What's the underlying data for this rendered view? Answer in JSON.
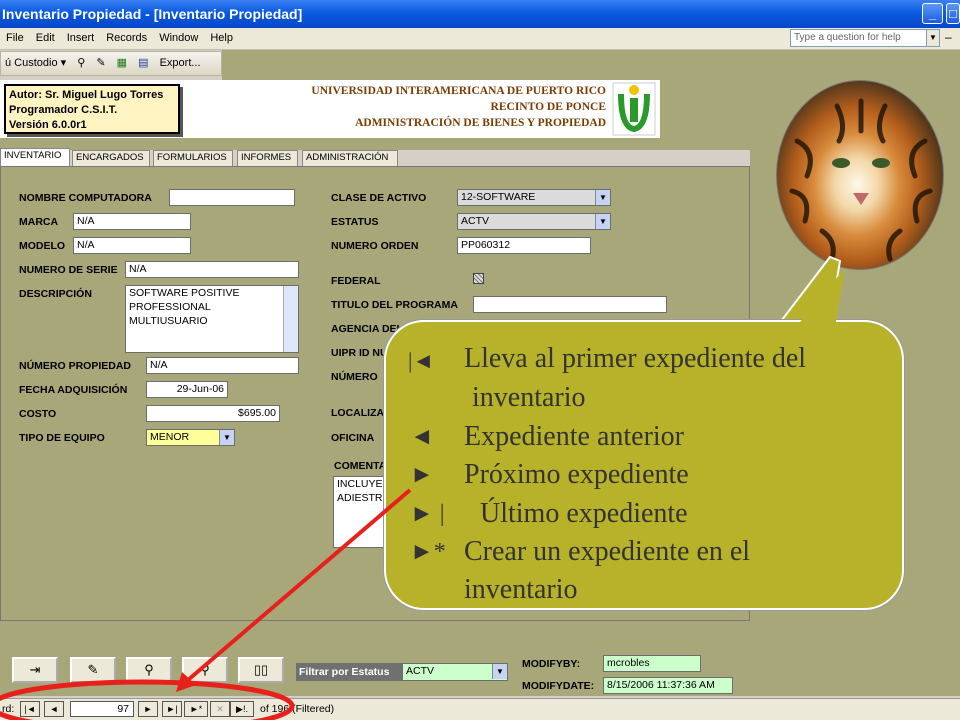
{
  "window": {
    "title": "Inventario Propiedad - [Inventario Propiedad]"
  },
  "menu": {
    "items": [
      "File",
      "Edit",
      "Insert",
      "Records",
      "Window",
      "Help"
    ],
    "ask_placeholder": "Type a question for help"
  },
  "toolbar": {
    "menu_label": "ú Custodio ▾",
    "export_label": "Export..."
  },
  "header": {
    "author_lines": [
      "Autor: Sr. Miguel Lugo Torres",
      "Programador C.S.I.T.",
      "Versión 6.0.0r1"
    ],
    "uni_lines": [
      "UNIVERSIDAD INTERAMERICANA DE PUERTO RICO",
      "RECINTO DE PONCE",
      "ADMINISTRACIÓN DE BIENES Y PROPIEDAD"
    ]
  },
  "tabs": [
    "INVENTARIO",
    "ENCARGADOS",
    "FORMULARIOS",
    "INFORMES",
    "ADMINISTRACIÓN"
  ],
  "form": {
    "nombre_computadora_label": "NOMBRE COMPUTADORA",
    "nombre_computadora": "",
    "marca_label": "MARCA",
    "marca": "N/A",
    "modelo_label": "MODELO",
    "modelo": "N/A",
    "serie_label": "NUMERO DE SERIE",
    "serie": "N/A",
    "descripcion_label": "DESCRIPCIÓN",
    "descripcion_lines": [
      "SOFTWARE POSITIVE",
      "PROFESSIONAL",
      "MULTIUSUARIO"
    ],
    "propiedad_label": "NÚMERO PROPIEDAD",
    "propiedad": "N/A",
    "fecha_label": "FECHA ADQUISICIÓN",
    "fecha": "29-Jun-06",
    "costo_label": "COSTO",
    "costo": "$695.00",
    "tipo_label": "TIPO DE EQUIPO",
    "tipo": "MENOR",
    "clase_label": "CLASE DE ACTIVO",
    "clase": "12-SOFTWARE",
    "estatus_label": "ESTATUS",
    "estatus": "ACTV",
    "orden_label": "NUMERO ORDEN",
    "orden": "PP060312",
    "federal_label": "FEDERAL",
    "titulo_label": "TITULO DEL PROGRAMA",
    "titulo": "",
    "agencia_label": "AGENCIA DEL F",
    "uipr_label": "UIPR ID NU",
    "numero_label": "NÚMERO",
    "localiza_label": "LOCALIZA",
    "oficina_label": "OFICINA",
    "comentarios_label": "COMENTA",
    "comentarios_lines": [
      "INCLUYE",
      "ADIESTR"
    ]
  },
  "bottom": {
    "filtrar_label": "Filtrar por Estatus",
    "filtrar_value": "ACTV",
    "modifyby_label": "MODIFYBY:",
    "modifyby": "mcrobles",
    "modifydate_label": "MODIFYDATE:",
    "modifydate": "8/15/2006 11:37:36 AM"
  },
  "nav": {
    "label": "rd:",
    "current": "97",
    "of_text": "of  196 (Filtered)"
  },
  "callout": {
    "lines": [
      {
        "sym": "|◄",
        "text": "Lleva al primer expediente del"
      },
      {
        "sym": "",
        "text": "inventario"
      },
      {
        "sym": "◄",
        "text": "Expediente anterior"
      },
      {
        "sym": "►",
        "text": "Próximo expediente"
      },
      {
        "sym": "► |",
        "text": "Último expediente"
      },
      {
        "sym": "►*",
        "text": "Crear un expediente en el"
      },
      {
        "sym": "",
        "text": "inventario"
      }
    ]
  },
  "colors": {
    "form_bg": "#a7a77a",
    "bubble": "#b8b22a",
    "arrow": "#e8201c",
    "title_bar": "#0a5ae0"
  }
}
